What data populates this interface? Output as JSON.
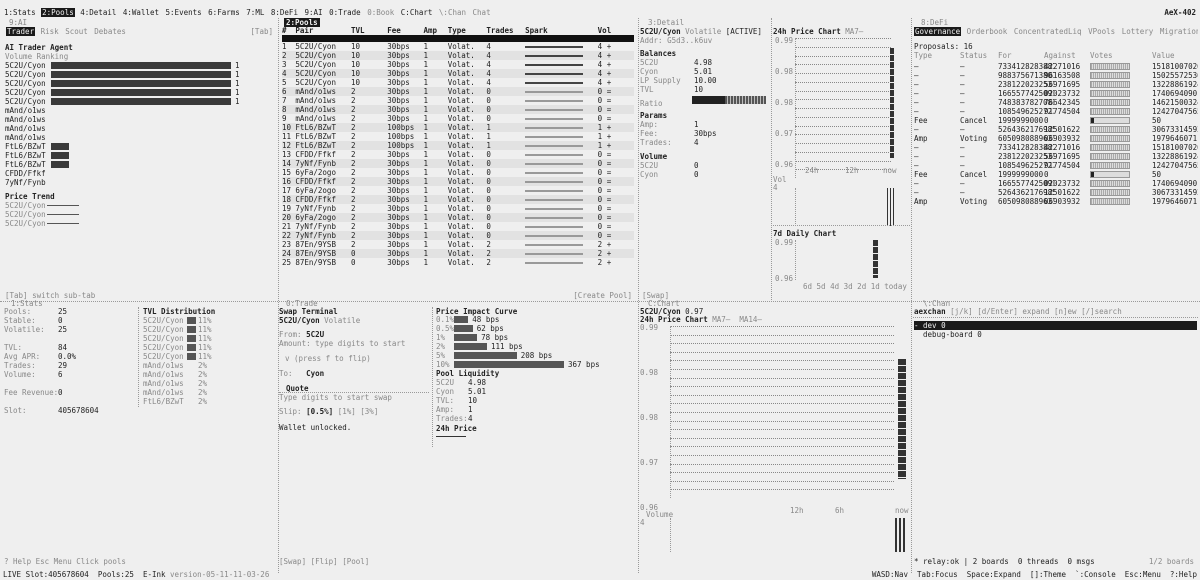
{
  "topbar": {
    "tabs": [
      "1:Stats",
      "2:Pools",
      "4:Detail",
      "4:Wallet",
      "5:Events",
      "6:Farms",
      "7:ML",
      "8:DeFi",
      "9:AI",
      "0:Trade",
      "0:Book",
      "C:Chart",
      "\\:Chan",
      "Chat"
    ],
    "active_tab": 1,
    "right_label": "AeX-402"
  },
  "ai_panel": {
    "title": "9:AI",
    "tabs": [
      "Trader",
      "Risk",
      "Scout",
      "Debates"
    ],
    "tab_hint": "[Tab]",
    "heading": "AI Trader Agent",
    "sub": "Volume Ranking",
    "rows": [
      {
        "label": "5C2U/Cyon",
        "fill": 1.0,
        "val": "1"
      },
      {
        "label": "5C2U/Cyon",
        "fill": 1.0,
        "val": "1"
      },
      {
        "label": "5C2U/Cyon",
        "fill": 1.0,
        "val": "1"
      },
      {
        "label": "5C2U/Cyon",
        "fill": 1.0,
        "val": "1"
      },
      {
        "label": "5C2U/Cyon",
        "fill": 1.0,
        "val": "1"
      },
      {
        "label": "mAnd/o1ws",
        "fill": 0,
        "val": ""
      },
      {
        "label": "mAnd/o1ws",
        "fill": 0,
        "val": ""
      },
      {
        "label": "mAnd/o1ws",
        "fill": 0,
        "val": ""
      },
      {
        "label": "mAnd/o1ws",
        "fill": 0,
        "val": ""
      },
      {
        "label": "FtL6/BZwT",
        "fill": 0.1,
        "val": ""
      },
      {
        "label": "FtL6/BZwT",
        "fill": 0.1,
        "val": ""
      },
      {
        "label": "FtL6/BZwT",
        "fill": 0.1,
        "val": ""
      },
      {
        "label": "CFDD/Ffkf",
        "fill": 0,
        "val": ""
      },
      {
        "label": "7yNf/Fynb",
        "fill": 0,
        "val": ""
      }
    ],
    "trend_title": "Price Trend",
    "trend_rows": [
      "5C2U/Cyon",
      "5C2U/Cyon",
      "5C2U/Cyon"
    ],
    "footer": "[Tab] switch sub-tab"
  },
  "pools_panel": {
    "title": "2:Pools",
    "headers": [
      "#",
      "Pair",
      "TVL",
      "Fee",
      "Amp",
      "Type",
      "Trades",
      "Spark",
      "Vol"
    ],
    "rows": [
      [
        "1",
        "5C2U/Cyon",
        "10",
        "30bps",
        "1",
        "Volat.",
        "4",
        "",
        "4 +"
      ],
      [
        "2",
        "5C2U/Cyon",
        "10",
        "30bps",
        "1",
        "Volat.",
        "4",
        "",
        "4 +"
      ],
      [
        "3",
        "5C2U/Cyon",
        "10",
        "30bps",
        "1",
        "Volat.",
        "4",
        "",
        "4 +"
      ],
      [
        "4",
        "5C2U/Cyon",
        "10",
        "30bps",
        "1",
        "Volat.",
        "4",
        "",
        "4 +"
      ],
      [
        "5",
        "5C2U/Cyon",
        "10",
        "30bps",
        "1",
        "Volat.",
        "4",
        "",
        "4 +"
      ],
      [
        "6",
        "mAnd/o1ws",
        "2",
        "30bps",
        "1",
        "Volat.",
        "0",
        "",
        "0 ="
      ],
      [
        "7",
        "mAnd/o1ws",
        "2",
        "30bps",
        "1",
        "Volat.",
        "0",
        "",
        "0 ="
      ],
      [
        "8",
        "mAnd/o1ws",
        "2",
        "30bps",
        "1",
        "Volat.",
        "0",
        "",
        "0 ="
      ],
      [
        "9",
        "mAnd/o1ws",
        "2",
        "30bps",
        "1",
        "Volat.",
        "0",
        "",
        "0 ="
      ],
      [
        "10",
        "FtL6/BZwT",
        "2",
        "100bps",
        "1",
        "Volat.",
        "1",
        "",
        "1 +"
      ],
      [
        "11",
        "FtL6/BZwT",
        "2",
        "100bps",
        "1",
        "Volat.",
        "1",
        "",
        "1 +"
      ],
      [
        "12",
        "FtL6/BZwT",
        "2",
        "100bps",
        "1",
        "Volat.",
        "1",
        "",
        "1 +"
      ],
      [
        "13",
        "CFDD/Ffkf",
        "2",
        "30bps",
        "1",
        "Volat.",
        "0",
        "",
        "0 ="
      ],
      [
        "14",
        "7yNf/Fynb",
        "2",
        "30bps",
        "1",
        "Volat.",
        "0",
        "",
        "0 ="
      ],
      [
        "15",
        "6yFa/2ogo",
        "2",
        "30bps",
        "1",
        "Volat.",
        "0",
        "",
        "0 ="
      ],
      [
        "16",
        "CFDD/Ffkf",
        "2",
        "30bps",
        "1",
        "Volat.",
        "0",
        "",
        "0 ="
      ],
      [
        "17",
        "6yFa/2ogo",
        "2",
        "30bps",
        "1",
        "Volat.",
        "0",
        "",
        "0 ="
      ],
      [
        "18",
        "CFDD/Ffkf",
        "2",
        "30bps",
        "1",
        "Volat.",
        "0",
        "",
        "0 ="
      ],
      [
        "19",
        "7yNf/Fynb",
        "2",
        "30bps",
        "1",
        "Volat.",
        "0",
        "",
        "0 ="
      ],
      [
        "20",
        "6yFa/2ogo",
        "2",
        "30bps",
        "1",
        "Volat.",
        "0",
        "",
        "0 ="
      ],
      [
        "21",
        "7yNf/Fynb",
        "2",
        "30bps",
        "1",
        "Volat.",
        "0",
        "",
        "0 ="
      ],
      [
        "22",
        "7yNf/Fynb",
        "2",
        "30bps",
        "1",
        "Volat.",
        "0",
        "",
        "0 ="
      ],
      [
        "23",
        "87En/9YSB",
        "2",
        "30bps",
        "1",
        "Volat.",
        "2",
        "",
        "2 +"
      ],
      [
        "24",
        "87En/9YSB",
        "0",
        "30bps",
        "1",
        "Volat.",
        "2",
        "",
        "2 +"
      ],
      [
        "25",
        "87En/9YSB",
        "0",
        "30bps",
        "1",
        "Volat.",
        "2",
        "",
        "2 +"
      ]
    ],
    "footer": "[Create Pool]"
  },
  "detail_panel": {
    "title": "3:Detail",
    "pair": "5C2U/Cyon",
    "type": "Volatile",
    "status": "[ACTIVE]",
    "addr": "Addr: G5d3..k6uv",
    "balances_title": "Balances",
    "balances": [
      [
        "5C2U",
        "4.98"
      ],
      [
        "Cyon",
        "5.01"
      ],
      [
        "LP Supply",
        "10.00"
      ],
      [
        "TVL",
        "10"
      ]
    ],
    "ratio_label": "Ratio",
    "params_title": "Params",
    "params": [
      [
        "Amp:",
        "1"
      ],
      [
        "Fee:",
        "30bps"
      ],
      [
        "Trades:",
        "4"
      ]
    ],
    "volume_title": "Volume",
    "volume": [
      [
        "5C2U",
        "0"
      ],
      [
        "Cyon",
        "0"
      ]
    ],
    "footer": "[Swap]"
  },
  "price_chart_small": {
    "title": "24h Price Chart",
    "ma": "MA7—",
    "y_labels": [
      "0.99",
      "0.98",
      "0.98",
      "0.97",
      "0.96"
    ],
    "x_labels": [
      "24h",
      "12h",
      "now"
    ],
    "vol_label": "Vol",
    "vol_value": "4"
  },
  "daily_chart": {
    "title": "7d Daily Chart",
    "y_labels": [
      "0.99",
      "0.96"
    ],
    "x_labels": [
      "6d",
      "5d",
      "4d",
      "3d",
      "2d",
      "1d",
      "today"
    ]
  },
  "defi_panel": {
    "title": "8:DeFi",
    "tabs": [
      "Governance",
      "Orderbook",
      "ConcentratedLiq",
      "VPools",
      "Lottery",
      "Migration"
    ],
    "proposals_label": "Proposals: 16",
    "headers": [
      "Type",
      "Status",
      "For",
      "Against",
      "Votes",
      "Value"
    ],
    "rows": [
      [
        "—",
        "—",
        "7334128283881341",
        "42271016",
        "",
        "15181007026"
      ],
      [
        "—",
        "—",
        "9883756713801833",
        "96163508",
        "",
        "15025572536"
      ],
      [
        "—",
        "—",
        "2381220232531176",
        "56971695",
        "",
        "13228861924"
      ],
      [
        "—",
        "—",
        "1665577425091765",
        "02023732",
        "",
        "17406940901"
      ],
      [
        "—",
        "—",
        "7483837827081328",
        "76642345",
        "",
        "14621500324"
      ],
      [
        "—",
        "—",
        "1085496252727952",
        "91774504",
        "",
        "12427047565"
      ],
      [
        "Fee",
        "Cancel",
        "1999999000",
        "0",
        "",
        "50"
      ],
      [
        "—",
        "—",
        "5264362176985926",
        "12501622",
        "",
        "30673314592"
      ],
      [
        "Amp",
        "Voting",
        "6050980889631098",
        "06903932",
        "",
        "19796460711"
      ],
      [
        "—",
        "—",
        "7334128283881341",
        "42271016",
        "",
        "15181007026"
      ],
      [
        "—",
        "—",
        "2381220232531176",
        "56971695",
        "",
        "13228861924"
      ],
      [
        "—",
        "—",
        "1085496252727952",
        "91774504",
        "",
        "12427047565"
      ],
      [
        "Fee",
        "Cancel",
        "1999999000",
        "0",
        "",
        "50"
      ],
      [
        "—",
        "—",
        "1665577425091765",
        "02023732",
        "",
        "17406940901"
      ],
      [
        "—",
        "—",
        "5264362176985926",
        "12501622",
        "",
        "30673314592"
      ],
      [
        "Amp",
        "Voting",
        "6050980889631098",
        "06903932",
        "",
        "19796460711"
      ]
    ]
  },
  "stats_panel": {
    "title": "1:Stats",
    "rows": [
      [
        "Pools:",
        "25"
      ],
      [
        "Stable:",
        "0"
      ],
      [
        "Volatile:",
        "25"
      ],
      [
        "",
        ""
      ],
      [
        "TVL:",
        "84"
      ],
      [
        "Avg APR:",
        "0.0%"
      ],
      [
        "Trades:",
        "29"
      ],
      [
        "Volume:",
        "6"
      ],
      [
        "",
        ""
      ],
      [
        "Fee Revenue:",
        "0"
      ],
      [
        "",
        ""
      ],
      [
        "Slot:",
        "405678604"
      ]
    ],
    "tvl_title": "TVL Distribution",
    "tvl_rows": [
      {
        "label": "5C2U/Cyon",
        "pct": "11%",
        "fill": 1
      },
      {
        "label": "5C2U/Cyon",
        "pct": "11%",
        "fill": 1
      },
      {
        "label": "5C2U/Cyon",
        "pct": "11%",
        "fill": 1
      },
      {
        "label": "5C2U/Cyon",
        "pct": "11%",
        "fill": 1
      },
      {
        "label": "5C2U/Cyon",
        "pct": "11%",
        "fill": 1
      },
      {
        "label": "mAnd/o1ws",
        "pct": "2%",
        "fill": 0
      },
      {
        "label": "mAnd/o1ws",
        "pct": "2%",
        "fill": 0
      },
      {
        "label": "mAnd/o1ws",
        "pct": "2%",
        "fill": 0
      },
      {
        "label": "mAnd/o1ws",
        "pct": "2%",
        "fill": 0
      },
      {
        "label": "FtL6/BZwT",
        "pct": "2%",
        "fill": 0
      }
    ],
    "footer": "? Help  Esc Menu  Click pools"
  },
  "trade_panel": {
    "title": "0:Trade",
    "heading": "Swap Terminal",
    "pair": "5C2U/Cyon",
    "type": "Volatile",
    "from_label": "From:",
    "from_val": "5C2U",
    "amount_hint": "Amount: type digits to start",
    "flip_hint": "v  (press f to flip)",
    "to_label": "To:",
    "to_val": "Cyon",
    "quote_title": "Quote",
    "quote_hint": "Type digits to start swap",
    "slip_label": "Slip:",
    "slip_opts": [
      "[0.5%]",
      "[1%]",
      "[3%]"
    ],
    "wallet": "Wallet unlocked.",
    "impact_title": "Price Impact Curve",
    "impact_rows": [
      {
        "pct": "0.1%",
        "bps": "48 bps",
        "fill": 0.13
      },
      {
        "pct": "0.5%",
        "bps": "62 bps",
        "fill": 0.17
      },
      {
        "pct": "1%",
        "bps": "78 bps",
        "fill": 0.21
      },
      {
        "pct": "2%",
        "bps": "111 bps",
        "fill": 0.3
      },
      {
        "pct": "5%",
        "bps": "208 bps",
        "fill": 0.57
      },
      {
        "pct": "10%",
        "bps": "367 bps",
        "fill": 1.0
      }
    ],
    "liq_title": "Pool Liquidity",
    "liq_rows": [
      [
        "5C2U",
        "4.98"
      ],
      [
        "Cyon",
        "5.01"
      ],
      [
        "TVL:",
        "10"
      ],
      [
        "Amp:",
        "1"
      ],
      [
        "Trades:",
        "4"
      ]
    ],
    "price_title": "24h Price",
    "footer": "[Swap] [Flip] [Pool]"
  },
  "chart_panel": {
    "title": "C:Chart",
    "pair": "5C2U/Cyon",
    "price": "0.97",
    "chart_title": "24h Price Chart",
    "ma": "MA7—  MA14—",
    "y_labels": [
      "0.99",
      "0.98",
      "0.98",
      "0.97",
      "0.96"
    ],
    "x_labels": [
      "12h",
      "6h",
      "now"
    ],
    "vol_label": "Volume",
    "vol_value": "4"
  },
  "chan_panel": {
    "title": "\\:Chan",
    "heading": "aexchan",
    "hint": "[j/k] [d/Enter] expand [n]ew [/]search",
    "items": [
      "- dev 0",
      "  debug-board 0"
    ],
    "footer_left": "* relay:ok | 2 boards  0 threads  0 msgs",
    "footer_right": "1/2 boards"
  },
  "statusbar": {
    "left": "LIVE Slot:405678604  Pools:25  E-Ink",
    "version": "version-05-11-11-03-26",
    "right": "WASD:Nav  Tab:Focus  Space:Expand  []:Theme  `:Console  Esc:Menu  ?:Help"
  }
}
